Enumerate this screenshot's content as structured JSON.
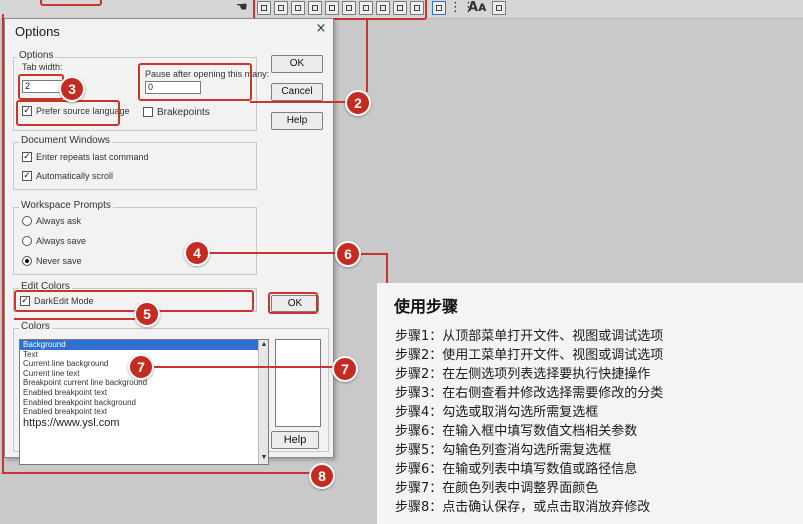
{
  "toolbar": {
    "icons": [
      "hand-icon",
      "window-icon",
      "window-icon",
      "window-icon",
      "window-icon",
      "window-icon",
      "window-icon",
      "window-icon",
      "window-icon",
      "window-icon",
      "window-icon",
      "page-icon",
      "grid-icon",
      "font-size-icon",
      "properties-icon"
    ]
  },
  "dialog": {
    "title": "Options",
    "close_glyph": "×",
    "ok_label": "OK",
    "cancel_label": "Cancel",
    "help_label": "Help",
    "options_group": {
      "label": "Options",
      "tab_width_label": "Tab width:",
      "tab_width_value": "2",
      "pause_label": "Pause after opening this many:",
      "pause_value": "0",
      "prefer_source_label": "Prefer source language",
      "prefer_source_checked": true,
      "breakpoints_label": "Brakepoints",
      "breakpoints_checked": false
    },
    "document_windows": {
      "label": "Document Windows",
      "items": [
        {
          "label": "Enter repeats last command",
          "checked": true
        },
        {
          "label": "Automatically scroll",
          "checked": true
        }
      ]
    },
    "workspace_prompts": {
      "label": "Workspace Prompts",
      "items": [
        {
          "label": "Always ask",
          "selected": false
        },
        {
          "label": "Always save",
          "selected": false
        },
        {
          "label": "Never save",
          "selected": true
        }
      ]
    },
    "edit_colors": {
      "label": "Edit Colors",
      "dark_edit_label": "DarkEdit Mode",
      "dark_edit_checked": true,
      "ok_label": "OK"
    },
    "colors": {
      "label": "Colors",
      "items": [
        "Background",
        "Text",
        "Current line background",
        "Current line text",
        "Breakpoint current line background",
        "Enabled breakpoint text",
        "Enabled breakpoint background",
        "Enabled breakpoint text"
      ],
      "selected_index": 0,
      "url_text": "https://www.ysl.com",
      "help_label": "Help",
      "scroll_up": "▲",
      "scroll_down": "▼"
    }
  },
  "annotations": {
    "badges": [
      "3",
      "2",
      "4",
      "6",
      "5",
      "7",
      "7",
      "8"
    ],
    "color": "#c8352c"
  },
  "panel": {
    "title": "使用步骤",
    "steps": [
      "步骤1：从顶部菜单打开文件、视图或调试选项",
      "步骤2：使用工菜单打开文件、视图或调试选项",
      "步骤2：在左侧选项列表选择要执行快捷操作",
      "步骤3：在右侧查看并修改选择需要修改的分类",
      "步骤4：勾选或取消勾选所需复选框",
      "步骤6：在输入框中填写数值文档相关参数",
      "步骤5：勾输色列查消勾选所需复选框",
      "步骤6：在输或列表中填写数值或路径信息",
      "步骤7：在颜色列表中调整界面颜色",
      "步骤8：点击确认保存，或点击取消放弃修改"
    ]
  }
}
